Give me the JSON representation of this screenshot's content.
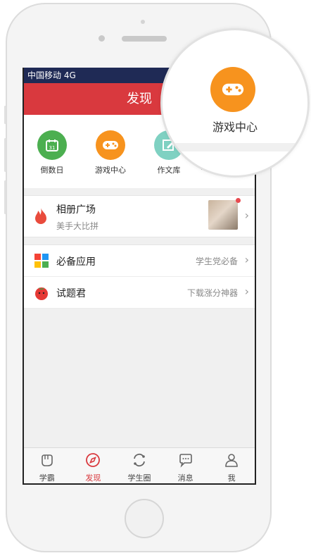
{
  "status_bar": {
    "carrier": "中国移动 4G"
  },
  "header": {
    "title": "发现"
  },
  "quick_items": [
    {
      "label": "倒数日",
      "icon": "calendar-icon",
      "color": "#4caf50"
    },
    {
      "label": "游戏中心",
      "icon": "gamepad-icon",
      "color": "#f7931e"
    },
    {
      "label": "作文库",
      "icon": "pencil-icon",
      "color": "#7fd1c2"
    }
  ],
  "album": {
    "title": "相册广场",
    "subtitle": "美手大比拼",
    "icon": "flame-icon"
  },
  "list": [
    {
      "title": "必备应用",
      "right": "学生党必备",
      "icon": "apps-grid-icon"
    },
    {
      "title": "试题君",
      "right": "下载涨分神器",
      "icon": "tomato-icon"
    }
  ],
  "tabs": [
    {
      "label": "学霸",
      "icon": "fist-icon",
      "active": false
    },
    {
      "label": "发现",
      "icon": "compass-icon",
      "active": true
    },
    {
      "label": "学生圈",
      "icon": "circle-arrows-icon",
      "active": false
    },
    {
      "label": "消息",
      "icon": "chat-bubble-icon",
      "active": false
    },
    {
      "label": "我",
      "icon": "person-icon",
      "active": false
    }
  ],
  "magnifier": {
    "label": "游戏中心",
    "icon": "gamepad-icon",
    "color": "#f7931e"
  },
  "colors": {
    "accent": "#d9393e",
    "status_bar": "#1f2a55"
  }
}
